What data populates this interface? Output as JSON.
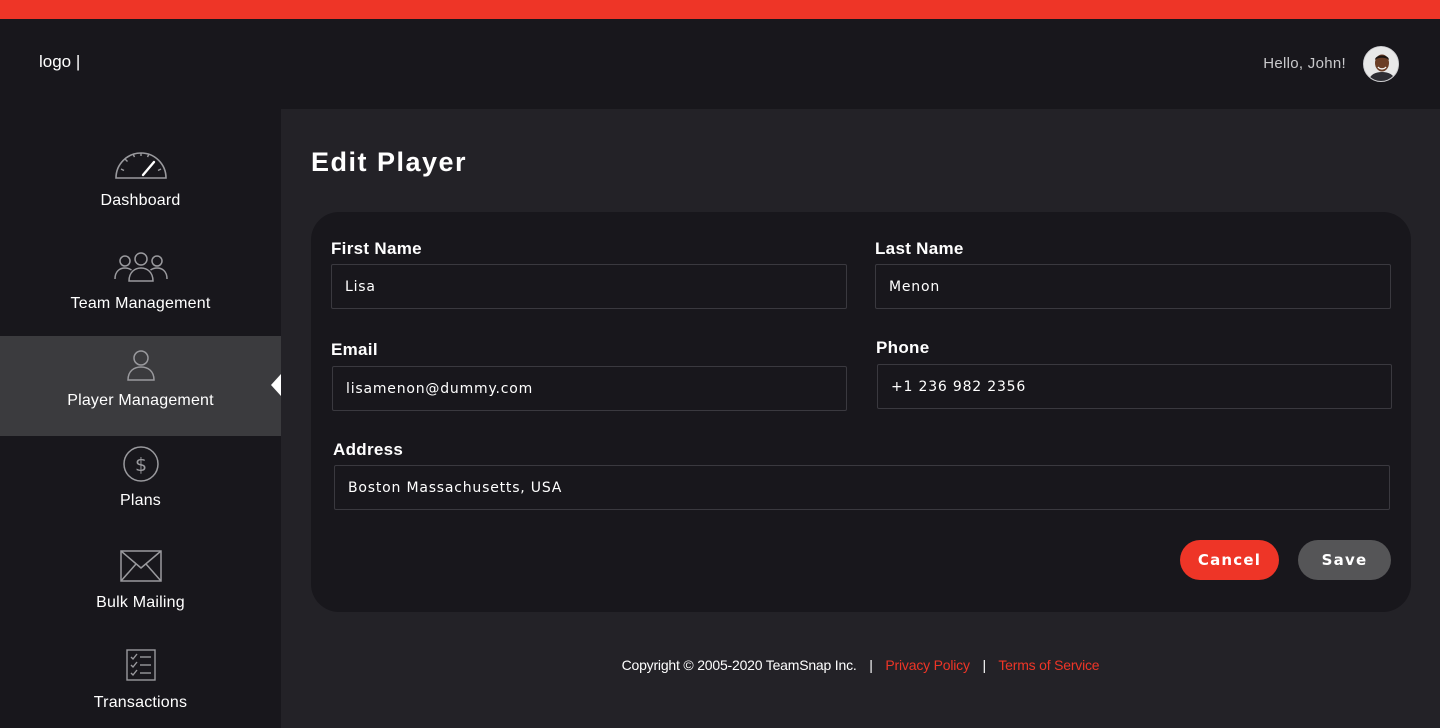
{
  "brand": {
    "logo_text": "logo |",
    "accent_color": "#ee3527"
  },
  "header": {
    "greeting": "Hello, John!",
    "avatar_icon": "user-avatar"
  },
  "sidebar": {
    "items": [
      {
        "label": "Dashboard",
        "icon": "speedometer-icon",
        "active": false
      },
      {
        "label": "Team Management",
        "icon": "team-icon",
        "active": false
      },
      {
        "label": "Player Management",
        "icon": "user-icon",
        "active": true
      },
      {
        "label": "Plans",
        "icon": "dollar-icon",
        "active": false
      },
      {
        "label": "Bulk Mailing",
        "icon": "envelope-icon",
        "active": false
      },
      {
        "label": "Transactions",
        "icon": "checklist-icon",
        "active": false
      }
    ]
  },
  "page": {
    "title": "Edit Player"
  },
  "form": {
    "first_name": {
      "label": "First Name",
      "value": "Lisa"
    },
    "last_name": {
      "label": "Last Name",
      "value": "Menon"
    },
    "email": {
      "label": "Email",
      "value": "lisamenon@dummy.com"
    },
    "phone": {
      "label": "Phone",
      "value": "+1 236 982 2356"
    },
    "address": {
      "label": "Address",
      "value": "Boston Massachusetts, USA"
    },
    "cancel_label": "Cancel",
    "save_label": "Save"
  },
  "footer": {
    "copyright": "Copyright © 2005-2020 TeamSnap Inc.",
    "separator": "|",
    "privacy_label": "Privacy Policy",
    "terms_label": "Terms of Service"
  }
}
